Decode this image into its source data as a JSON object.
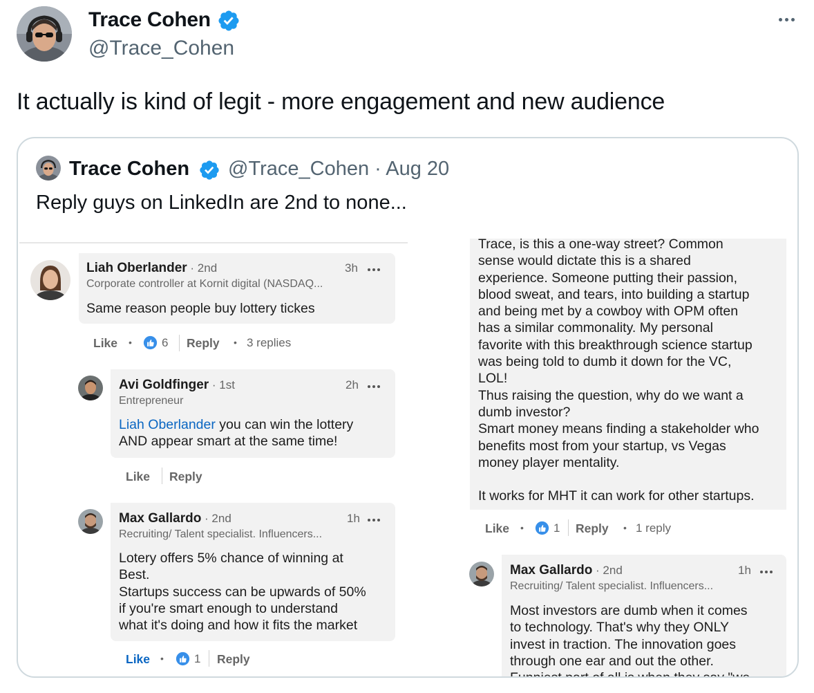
{
  "tweet": {
    "author_name": "Trace Cohen",
    "author_handle": "@Trace_Cohen",
    "text": "It actually is kind of legit - more engagement and new audience",
    "more_icon": "more-horizontal-icon",
    "verified_icon": "verified-badge-icon"
  },
  "quote": {
    "author_name": "Trace Cohen",
    "handle_date": "@Trace_Cohen · Aug 20",
    "text": "Reply guys on LinkedIn are 2nd to none..."
  },
  "linkedin": {
    "comment1": {
      "name": "Liah Oberlander",
      "degree": " · 2nd",
      "subtitle": "Corporate controller at Kornit digital (NASDAQ...",
      "time": "3h",
      "body": "Same reason people buy lottery tickes",
      "like": "Like",
      "reaction_count": "6",
      "reply": "Reply",
      "replies": "3 replies"
    },
    "reply1": {
      "name": "Avi Goldfinger",
      "degree": " · 1st",
      "subtitle": "Entrepreneur",
      "time": "2h",
      "mention": "Liah Oberlander",
      "body_line1": " you can win the lottery",
      "body_line2": "AND appear smart at the same time!",
      "like": "Like",
      "reply": "Reply"
    },
    "reply2": {
      "name": "Max Gallardo",
      "degree": " · 2nd",
      "subtitle": "Recruiting/ Talent specialist. Influencers...",
      "time": "1h",
      "body": "Lotery offers 5% chance of winning at\nBest.\nStartups success can be upwards of 50%\nif you're smart enough to understand\nwhat it's doing and how it fits the market",
      "like": "Like",
      "reaction_count": "1",
      "reply": "Reply"
    },
    "right_comment": {
      "body": "Trace, is this a one-way street? Common\nsense would dictate this is a shared\nexperience. Someone putting their passion,\nblood sweat, and tears, into building a startup\nand being met by a cowboy with OPM often\nhas a similar commonality. My personal\nfavorite with this breakthrough science startup\nwas being told to dumb it down for the VC,\nLOL!\nThus raising the question, why do we want a\ndumb investor?\nSmart money means finding a stakeholder who\nbenefits most from your startup, vs Vegas\nmoney player mentality.\n\nIt works for MHT it can work for other startups.",
      "like": "Like",
      "reaction_count": "1",
      "reply": "Reply",
      "replies": "1 reply"
    },
    "reply3": {
      "name": "Max Gallardo",
      "degree": " · 2nd",
      "subtitle": "Recruiting/ Talent specialist. Influencers...",
      "time": "1h",
      "body": "Most investors are dumb when it comes\nto technology. That's why they ONLY\ninvest in traction. The innovation goes\nthrough one ear and out the other.\nFunniest part of all is when they say \"we"
    }
  },
  "colors": {
    "verified_blue": "#1d9bf0",
    "linkedin_blue": "#0a66c2",
    "bubble_gray": "#f2f2f2"
  }
}
